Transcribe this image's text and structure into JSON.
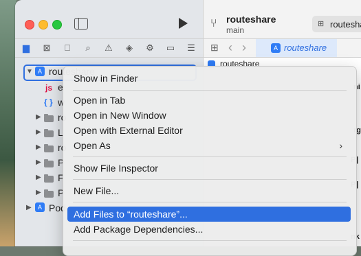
{
  "toolbar": {
    "project_name": "routeshare",
    "branch": "main",
    "scheme": "routeshare"
  },
  "editor": {
    "active_tab": "routeshare",
    "breadcrumb": "routeshare",
    "side_fragments": [
      "ni",
      "rg",
      "P]",
      "P]",
      "nk"
    ]
  },
  "navigator": {
    "icons": [
      "folder-icon",
      "source-control-icon",
      "bookmark-icon",
      "find-icon",
      "issue-icon",
      "test-icon",
      "debug-icon",
      "breakpoint-icon",
      "report-icon"
    ],
    "root": "routeshare",
    "items": [
      {
        "label": "e",
        "kind": "js"
      },
      {
        "label": "w",
        "kind": "json"
      },
      {
        "label": "ro",
        "kind": "folder"
      },
      {
        "label": "L",
        "kind": "folder"
      },
      {
        "label": "ro",
        "kind": "folder"
      },
      {
        "label": "P",
        "kind": "folder"
      },
      {
        "label": "F",
        "kind": "folder"
      },
      {
        "label": "P",
        "kind": "folder"
      },
      {
        "label": "Pod",
        "kind": "project"
      }
    ]
  },
  "context_menu": {
    "items": [
      {
        "label": "Show in Finder"
      },
      {
        "label": "Open in Tab"
      },
      {
        "label": "Open in New Window"
      },
      {
        "label": "Open with External Editor"
      },
      {
        "label": "Open As",
        "submenu": "›"
      },
      {
        "label": "Show File Inspector"
      },
      {
        "label": "New File..."
      },
      {
        "label": "Add Files to “routeshare”..."
      },
      {
        "label": "Add Package Dependencies..."
      }
    ],
    "highlighted_index": 7
  }
}
